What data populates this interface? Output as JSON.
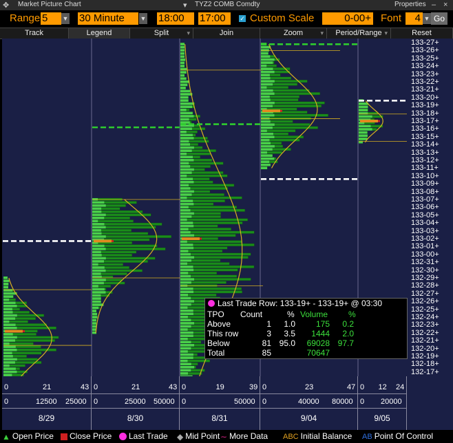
{
  "window": {
    "title": "Market Picture Chart",
    "ticker": "TYZ2 COMB Comdty",
    "properties_label": "Properties"
  },
  "toolbar": {
    "range_label": "Range",
    "range_value": "5",
    "interval_value": "30 Minute",
    "start_time": "18:00",
    "end_time": "17:00",
    "custom_scale_label": "Custom Scale",
    "custom_scale_checked": true,
    "scale_value": "0-00+",
    "font_label": "Font",
    "font_value": "4",
    "go_label": "Go"
  },
  "menu": [
    {
      "label": "Track",
      "has_arrow": false
    },
    {
      "label": "Legend",
      "has_arrow": false,
      "active": true
    },
    {
      "label": "Split",
      "has_arrow": true
    },
    {
      "label": "Join",
      "has_arrow": false
    },
    {
      "label": "Zoom",
      "has_arrow": true
    },
    {
      "label": "Period/Range",
      "has_arrow": true
    },
    {
      "label": "Reset",
      "has_arrow": false
    }
  ],
  "price_ticks": [
    "133-27+",
    "133-26+",
    "133-25+",
    "133-24+",
    "133-23+",
    "133-22+",
    "133-21+",
    "133-20+",
    "133-19+",
    "133-18+",
    "133-17+",
    "133-16+",
    "133-15+",
    "133-14+",
    "133-13+",
    "133-12+",
    "133-11+",
    "133-10+",
    "133-09+",
    "133-08+",
    "133-07+",
    "133-06+",
    "133-05+",
    "133-04+",
    "133-03+",
    "133-02+",
    "133-01+",
    "133-00+",
    "132-31+",
    "132-30+",
    "132-29+",
    "132-28+",
    "132-27+",
    "132-26+",
    "132-25+",
    "132-24+",
    "132-23+",
    "132-22+",
    "132-21+",
    "132-20+",
    "132-19+",
    "132-18+",
    "132-17+"
  ],
  "sessions": [
    {
      "date": "8/29",
      "tpo_scale": [
        "0",
        "21",
        "43"
      ],
      "vol_scale": [
        "0",
        "12500",
        "25000"
      ]
    },
    {
      "date": "8/30",
      "tpo_scale": [
        "0",
        "21",
        "43"
      ],
      "vol_scale": [
        "0",
        "25000",
        "50000"
      ]
    },
    {
      "date": "8/31",
      "tpo_scale": [
        "0",
        "19",
        "39"
      ],
      "vol_scale": [
        "0",
        "",
        "50000"
      ]
    },
    {
      "date": "9/04",
      "tpo_scale": [
        "0",
        "23",
        "47"
      ],
      "vol_scale": [
        "0",
        "40000",
        "80000"
      ]
    },
    {
      "date": "9/05",
      "tpo_scale": [
        "0",
        "12",
        "24"
      ],
      "vol_scale": [
        "0",
        "",
        "20000"
      ]
    }
  ],
  "info": {
    "title": "Last Trade Row:  133-19+ - 133-19+ @  03:30",
    "headers": [
      "TPO",
      "Count",
      "%",
      "Volume",
      "%"
    ],
    "rows": [
      {
        "label": "Above",
        "count": "1",
        "pct": "1.0",
        "volume": "175",
        "vpct": "0.2"
      },
      {
        "label": "This row",
        "count": "3",
        "pct": "3.5",
        "volume": "1444",
        "vpct": "2.0"
      },
      {
        "label": "Below",
        "count": "81",
        "pct": "95.0",
        "volume": "69028",
        "vpct": "97.7"
      },
      {
        "label": "Total",
        "count": "85",
        "pct": "",
        "volume": "70647",
        "vpct": ""
      }
    ]
  },
  "legend": [
    {
      "label": "Open Price",
      "icon": "triangle-icon",
      "color": "#3ccf3c"
    },
    {
      "label": "Close Price",
      "icon": "square-icon",
      "color": "#d02020"
    },
    {
      "label": "Last Trade",
      "icon": "circle-icon",
      "color": "#ff2ee0"
    },
    {
      "label": "Mid Point",
      "icon": "diamond-icon",
      "color": "#aaaaaa"
    },
    {
      "label": "More Data",
      "icon": "wave-icon",
      "color": "#d02080"
    },
    {
      "label": "Initial Balance",
      "icon": "abc-icon",
      "color": "#e0a020",
      "glyph": "ABC"
    },
    {
      "label": "Point Of Control",
      "icon": "ab-icon",
      "color": "#3070e0",
      "glyph": "AB"
    }
  ],
  "colors": {
    "accent": "#ff9a00",
    "panel": "#1a1f45",
    "tpo_bar": "#1a8c1a",
    "tpo_bar_light": "#4ad04a",
    "curve": "#d8b020",
    "value_area": "#2ecc2e"
  }
}
